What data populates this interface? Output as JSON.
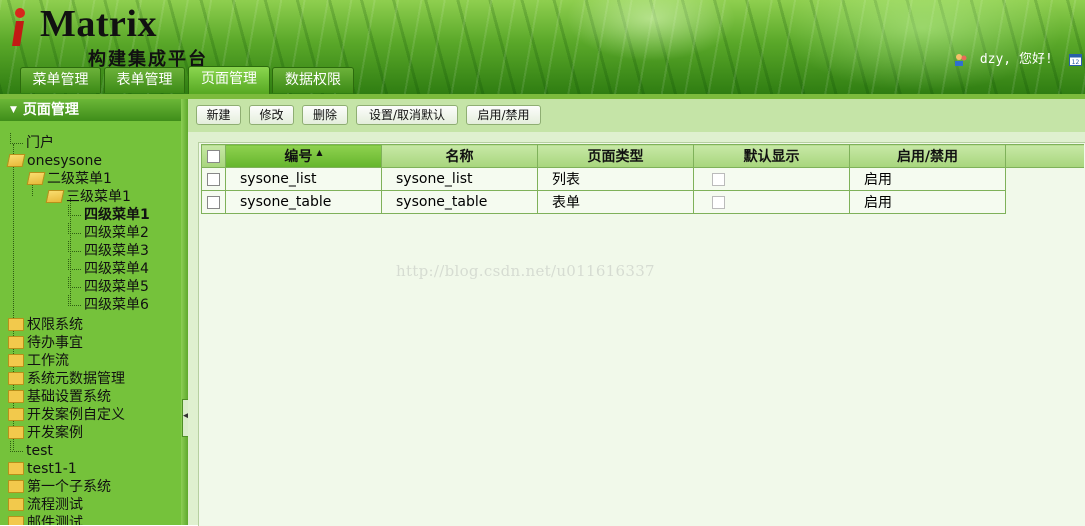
{
  "header": {
    "logo_text": "Matrix",
    "logo_subtitle": "构建集成平台",
    "user_greeting": "dzy, 您好!",
    "date_fragment": "20"
  },
  "tabs": [
    {
      "label": "菜单管理",
      "active": false
    },
    {
      "label": "表单管理",
      "active": false
    },
    {
      "label": "页面管理",
      "active": true
    },
    {
      "label": "数据权限",
      "active": false
    }
  ],
  "sidebar": {
    "title": "页面管理",
    "tree": [
      {
        "label": "门户",
        "icon": "leaf-line",
        "level": 0
      },
      {
        "label": "onesysone",
        "icon": "folder-open-icon",
        "level": 0
      },
      {
        "label": "二级菜单1",
        "icon": "folder-open-icon",
        "level": 1
      },
      {
        "label": "三级菜单1",
        "icon": "folder-open-icon",
        "level": 2
      },
      {
        "label": "四级菜单1",
        "icon": "leaf-line",
        "level": 3,
        "selected": true
      },
      {
        "label": "四级菜单2",
        "icon": "leaf-line",
        "level": 3
      },
      {
        "label": "四级菜单3",
        "icon": "leaf-line",
        "level": 3
      },
      {
        "label": "四级菜单4",
        "icon": "leaf-line",
        "level": 3
      },
      {
        "label": "四级菜单5",
        "icon": "leaf-line",
        "level": 3
      },
      {
        "label": "四级菜单6",
        "icon": "leaf-line",
        "level": 3
      },
      {
        "label": "权限系统",
        "icon": "folder-closed-icon",
        "level": 0
      },
      {
        "label": "待办事宜",
        "icon": "folder-closed-icon",
        "level": 0
      },
      {
        "label": "工作流",
        "icon": "folder-closed-icon",
        "level": 0
      },
      {
        "label": "系统元数据管理",
        "icon": "folder-closed-icon",
        "level": 0
      },
      {
        "label": "基础设置系统",
        "icon": "folder-closed-icon",
        "level": 0
      },
      {
        "label": "开发案例自定义",
        "icon": "folder-closed-icon",
        "level": 0
      },
      {
        "label": "开发案例",
        "icon": "folder-closed-icon",
        "level": 0
      },
      {
        "label": "test",
        "icon": "leaf-line",
        "level": 0
      },
      {
        "label": "test1-1",
        "icon": "folder-closed-icon",
        "level": 0
      },
      {
        "label": "第一个子系统",
        "icon": "folder-closed-icon",
        "level": 0
      },
      {
        "label": "流程测试",
        "icon": "folder-closed-icon",
        "level": 0
      },
      {
        "label": "邮件测试",
        "icon": "folder-closed-icon",
        "level": 0
      }
    ]
  },
  "toolbar": {
    "new_label": "新建",
    "edit_label": "修改",
    "delete_label": "删除",
    "set_default_label": "设置/取消默认",
    "enable_disable_label": "启用/禁用"
  },
  "grid": {
    "columns": [
      "编号",
      "名称",
      "页面类型",
      "默认显示",
      "启用/禁用"
    ],
    "sorted_column": "编号",
    "rows": [
      {
        "code": "sysone_list",
        "name": "sysone_list",
        "type": "列表",
        "default_checked": false,
        "status": "启用"
      },
      {
        "code": "sysone_table",
        "name": "sysone_table",
        "type": "表单",
        "default_checked": false,
        "status": "启用"
      }
    ]
  },
  "watermark": "http://blog.csdn.net/u011616337",
  "colors": {
    "header_green": "#5aa829",
    "sidebar_green": "#75c23b",
    "toolbar_green": "#c5e4a7",
    "content_bg": "#f1f9ea",
    "grid_border": "#7fb15a"
  }
}
